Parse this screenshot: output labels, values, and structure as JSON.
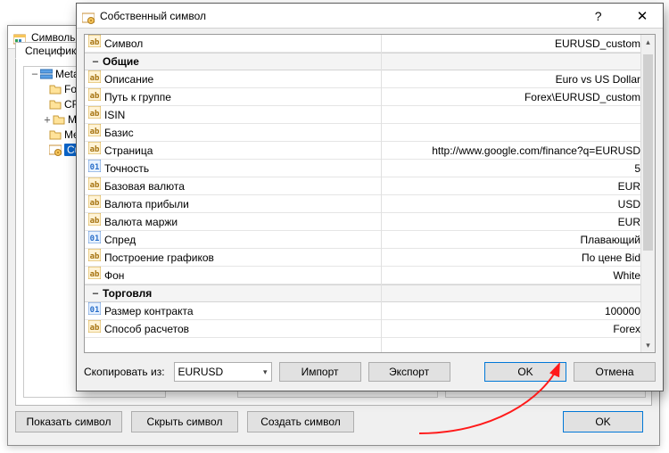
{
  "back_window": {
    "title": "Символы",
    "tab": "Спецификация",
    "tree": {
      "root": "MetaTrader",
      "items": [
        "For",
        "CFI",
        "MO",
        "Me",
        "Cus"
      ]
    },
    "buttons": {
      "show_symbol": "Показать символ",
      "hide_symbol": "Скрыть символ",
      "create_symbol": "Создать символ",
      "ok": "OK"
    }
  },
  "dialog": {
    "title": "Собственный символ",
    "help": "?",
    "close": "✕",
    "group1": "Общие",
    "group2": "Торговля",
    "rows": [
      {
        "icon": "ab",
        "key": "Символ",
        "val": "EURUSD_custom"
      },
      {
        "icon": "ab",
        "key": "Описание",
        "val": "Euro vs US Dollar"
      },
      {
        "icon": "ab",
        "key": "Путь к группе",
        "val": "Forex\\EURUSD_custom"
      },
      {
        "icon": "ab",
        "key": "ISIN",
        "val": ""
      },
      {
        "icon": "ab",
        "key": "Базис",
        "val": ""
      },
      {
        "icon": "ab",
        "key": "Страница",
        "val": "http://www.google.com/finance?q=EURUSD"
      },
      {
        "icon": "num",
        "key": "Точность",
        "val": "5"
      },
      {
        "icon": "ab",
        "key": "Базовая валюта",
        "val": "EUR"
      },
      {
        "icon": "ab",
        "key": "Валюта прибыли",
        "val": "USD"
      },
      {
        "icon": "ab",
        "key": "Валюта маржи",
        "val": "EUR"
      },
      {
        "icon": "num",
        "key": "Спред",
        "val": "Плавающий"
      },
      {
        "icon": "ab",
        "key": "Построение графиков",
        "val": "По цене Bid"
      },
      {
        "icon": "ab",
        "key": "Фон",
        "val": "White"
      },
      {
        "icon": "num",
        "key": "Размер контракта",
        "val": "100000"
      },
      {
        "icon": "ab",
        "key": "Способ расчетов",
        "val": "Forex"
      }
    ],
    "bottom": {
      "copy_from_label": "Скопировать из:",
      "copy_from_value": "EURUSD",
      "import": "Импорт",
      "export": "Экспорт",
      "ok": "OK",
      "cancel": "Отмена"
    }
  }
}
